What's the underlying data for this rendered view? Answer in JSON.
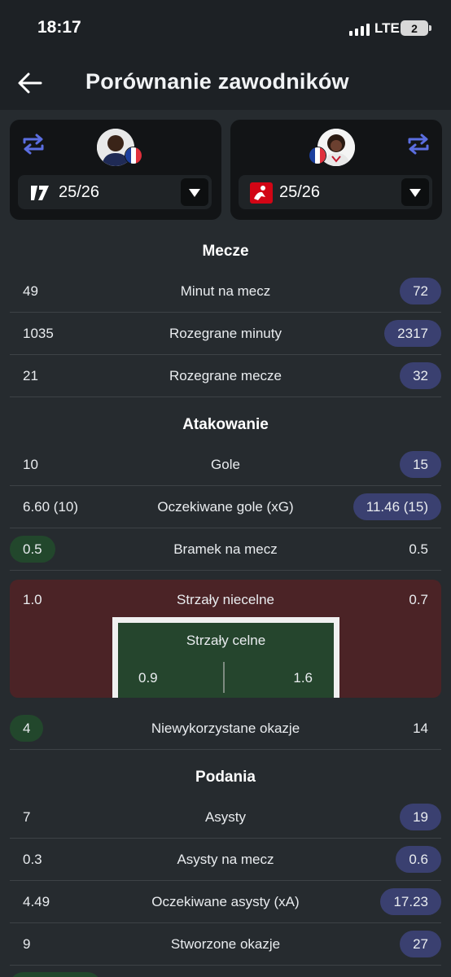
{
  "status": {
    "time": "18:17",
    "network": "LTE",
    "sim": "2"
  },
  "header": {
    "title": "Porównanie zawodników",
    "back_icon": "arrow-left-icon"
  },
  "players": {
    "left": {
      "season": "25/26",
      "league_icon": "ligue1-icon",
      "flag": "france"
    },
    "right": {
      "season": "25/26",
      "league_icon": "bundesliga-icon",
      "flag": "france"
    },
    "accent": "#5b6ee1"
  },
  "sections": {
    "matches": {
      "title": "Mecze",
      "rows": [
        {
          "label": "Minut na mecz",
          "left": "49",
          "right": "72"
        },
        {
          "label": "Rozegrane minuty",
          "left": "1035",
          "right": "2317"
        },
        {
          "label": "Rozegrane mecze",
          "left": "21",
          "right": "32"
        }
      ]
    },
    "attack": {
      "title": "Atakowanie",
      "rows": [
        {
          "label": "Gole",
          "left": "10",
          "right": "15"
        },
        {
          "label": "Oczekiwane gole (xG)",
          "left": "6.60 (10)",
          "right": "11.46 (15)"
        },
        {
          "label": "Bramek na mecz",
          "left": "0.5",
          "right": "0.5"
        }
      ],
      "shots_off": {
        "label": "Strzały niecelne",
        "left": "1.0",
        "right": "0.7"
      },
      "shots_on": {
        "label": "Strzały celne",
        "left": "0.9",
        "right": "1.6"
      },
      "missed": {
        "label": "Niewykorzystane okazje",
        "left": "4",
        "right": "14"
      }
    },
    "passing": {
      "title": "Podania",
      "rows": [
        {
          "label": "Asysty",
          "left": "7",
          "right": "19"
        },
        {
          "label": "Asysty na mecz",
          "left": "0.3",
          "right": "0.6"
        },
        {
          "label": "Oczekiwane asysty (xA)",
          "left": "4.49",
          "right": "17.23"
        },
        {
          "label": "Stworzone okazje",
          "left": "9",
          "right": "27"
        }
      ]
    }
  },
  "colors": {
    "better_right": "#3a4070",
    "better_left": "#22472c",
    "shots_bg": "#4b2326",
    "goal_bg": "#25452d"
  }
}
